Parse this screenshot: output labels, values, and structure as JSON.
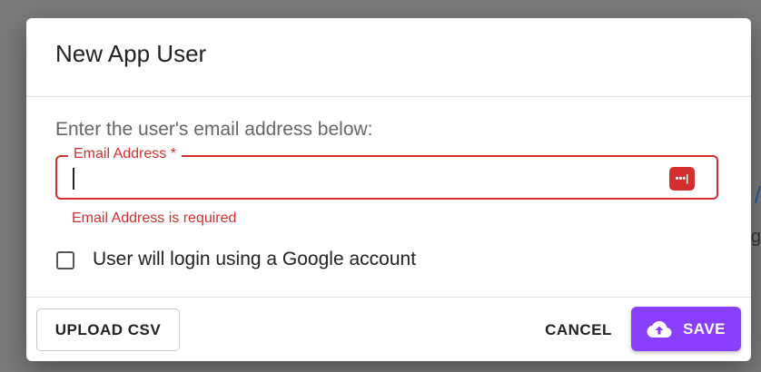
{
  "dialog": {
    "title": "New App User",
    "instructions": "Enter the user's email address below:",
    "email_field": {
      "label": "Email Address *",
      "value": "",
      "error": "Email Address is required",
      "trailing_icon": "password-manager-icon",
      "trailing_icon_text": "•••|"
    },
    "google_checkbox": {
      "label": "User will login using a Google account",
      "checked": false
    },
    "footer": {
      "upload_label": "UPLOAD CSV",
      "cancel_label": "CANCEL",
      "save_label": "SAVE",
      "save_icon": "cloud-upload-icon"
    }
  },
  "colors": {
    "accent": "#8a3ffc",
    "error": "#d32f2f"
  }
}
